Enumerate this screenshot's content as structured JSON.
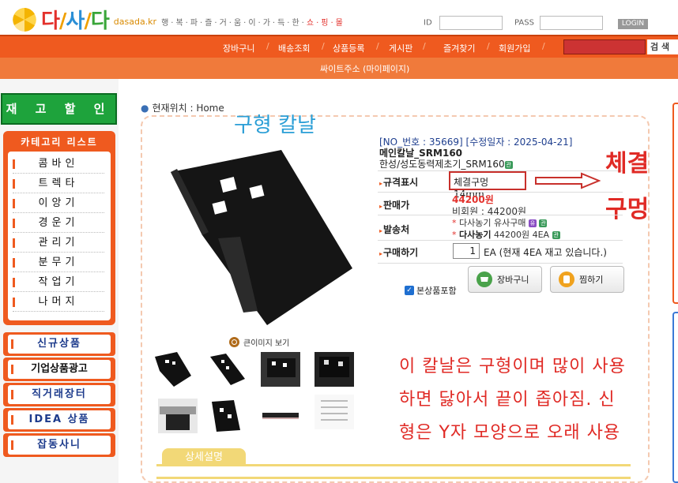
{
  "header": {
    "logo_text_1": "다",
    "logo_text_2": "/",
    "logo_text_3": "사",
    "logo_text_4": "/",
    "logo_text_5": "다",
    "domain": "dasada.kr",
    "slogan_a": "행·복·파·즐·거·움·이·가·득·한·",
    "slogan_b": "쇼·핑·몰",
    "id_label": "ID",
    "pass_label": "PASS",
    "login_label": "LOGIN"
  },
  "nav": {
    "items": [
      "장바구니",
      "배송조회",
      "상품등록",
      "게시판",
      "즐겨찾기",
      "회원가입"
    ],
    "search_label": "검 색",
    "sub_label": "싸이트주소 (마이페이지)"
  },
  "sidebar": {
    "discount_label": "재 고 할 인",
    "category_title": "카테고리 리스트",
    "categories": [
      "콤바인",
      "트렉타",
      "이앙기",
      "경운기",
      "관리기",
      "분무기",
      "작업기",
      "나머지"
    ],
    "buttons": [
      "신규상품",
      "기업상품광고",
      "직거래장터",
      "IDEA 상품",
      "잡동사니"
    ]
  },
  "breadcrumb": "현재위치 : Home",
  "annotation_title": "구형 칼날",
  "product": {
    "no_line": "[NO_번호 : 35669] [수정일자 : 2025-04-21]",
    "name": "메인칼날_SRM160",
    "maker": "한성/성도동력제초기_SRM160",
    "maker_badge": "관",
    "spec_label": "규격표시",
    "spec_value": "체결구멍 14mm",
    "price_label": "판매가",
    "price": "44200원",
    "member_price": "비회원 : 44200원",
    "ship_label": "발송처",
    "ship_line1": "다사농기 유사구매",
    "ship_badge1": "유",
    "ship_badge1b": "관",
    "ship_seller": "다사농기",
    "ship_line2_rest": " 44200원 4EA",
    "ship_badge2": "관",
    "buy_label": "구매하기",
    "qty": "1",
    "stock_text": "EA (현재 4EA 재고 있습니다.)",
    "include_label": "본상품포함",
    "cart_button": "장바구니",
    "wish_button": "찜하기",
    "zoom_label": "큰이미지 보기"
  },
  "callout": {
    "line1": "체결",
    "line2": "구멍"
  },
  "note": {
    "line1": "이 칼날은 구형이며 많이 사용",
    "line2": "하면 닳아서 끝이 좁아짐. 신",
    "line3": "형은 Y자 모양으로 오래 사용"
  },
  "detail_tab": "상세설명",
  "colors": {
    "accent": "#ef5a1f",
    "green": "#1ea33c",
    "note_red": "#e02a25",
    "title_blue": "#2a9ed6"
  }
}
